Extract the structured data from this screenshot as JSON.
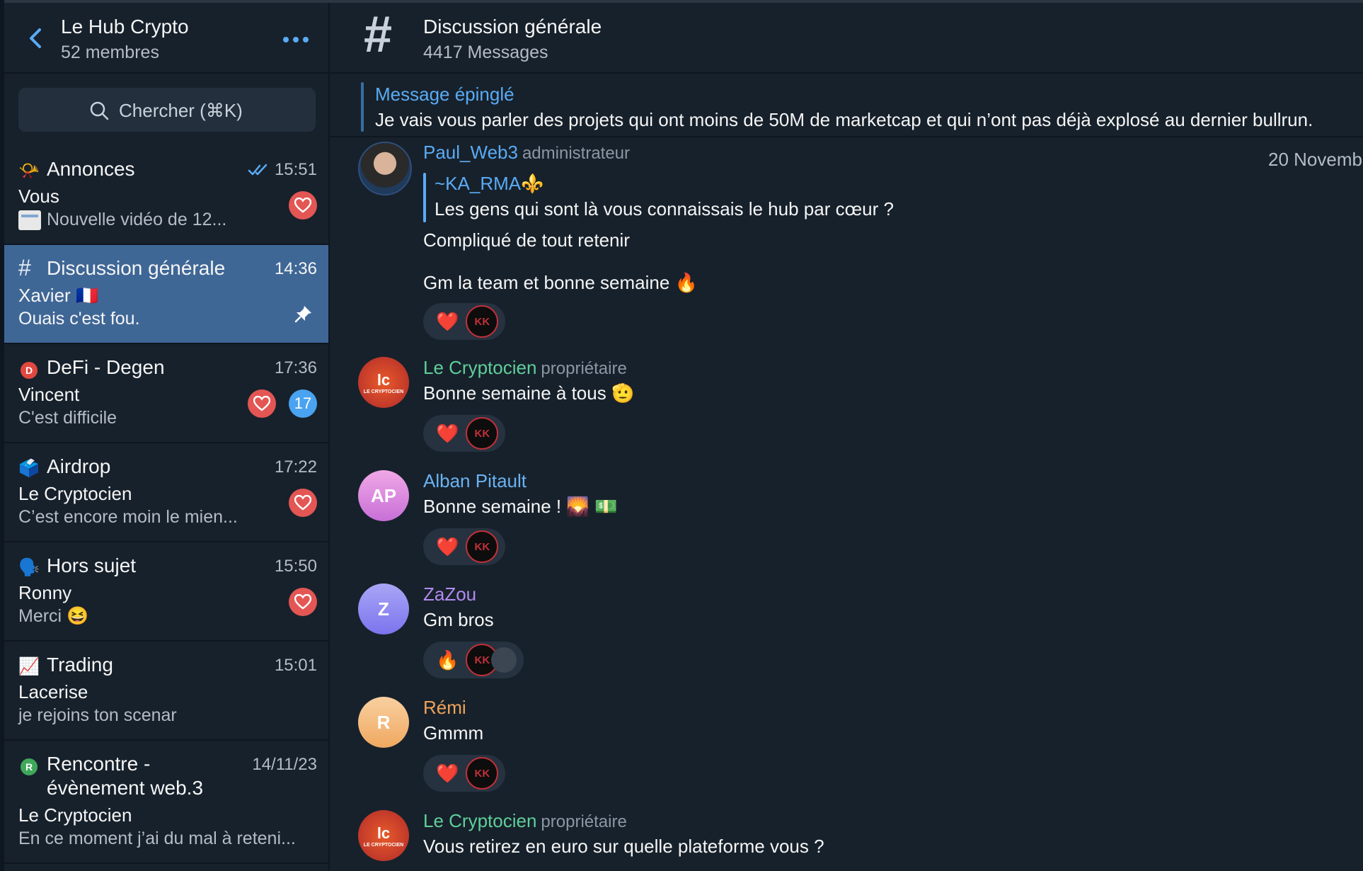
{
  "sidebar": {
    "title": "Le Hub Crypto",
    "subtitle": "52 membres",
    "search_placeholder": "Chercher (⌘K)",
    "chats": [
      {
        "emoji": "📯",
        "title": "Annonces",
        "time": "15:51",
        "sender": "Vous",
        "preview": "Nouvelle vidéo de 12..."
      },
      {
        "emoji": "#",
        "title": "Discussion générale",
        "time": "14:36",
        "sender": "Xavier 🇫🇷",
        "preview": "Ouais c'est fou."
      },
      {
        "emoji": "D",
        "title": "DeFi - Degen",
        "time": "17:36",
        "sender": "Vincent",
        "preview": "C'est difficile",
        "unread": "17"
      },
      {
        "emoji": "🗳️",
        "title": "Airdrop",
        "time": "17:22",
        "sender": "Le Cryptocien",
        "preview": "C’est encore moin le mien..."
      },
      {
        "emoji": "🗣️",
        "title": "Hors sujet",
        "time": "15:50",
        "sender": "Ronny",
        "preview": "Merci 😆"
      },
      {
        "emoji": "📈",
        "title": "Trading",
        "time": "15:01",
        "sender": "Lacerise",
        "preview": "je rejoins ton scenar"
      },
      {
        "emoji": "R",
        "title": "Rencontre - évènement web.3",
        "time": "14/11/23",
        "sender": "Le Cryptocien",
        "preview": "En ce moment j’ai du mal à reteni..."
      }
    ]
  },
  "colors": {
    "background": "#17212b",
    "active_item": "#3f6796",
    "accent": "#5aabf5",
    "heart_badge": "#e35654",
    "unread_badge": "#4aa3f0"
  },
  "main": {
    "channel_title": "Discussion générale",
    "channel_subtitle": "4417 Messages",
    "pinned_label": "Message épinglé",
    "pinned_text": "Je vais vous parler des projets qui ont moins de 50M de marketcap et qui n’ont pas déjà explosé au dernier bullrun.",
    "date": "20 Novemb",
    "messages": [
      {
        "author": "Paul_Web3",
        "role": "administrateur",
        "reply_name": "~KA_RMA⚜️",
        "reply_text": "Les gens qui sont là vous connaissais le hub par cœur ?",
        "lines": [
          "Compliqué de tout retenir",
          "Gm la team et bonne semaine 🔥"
        ],
        "reaction": "❤️"
      },
      {
        "author": "Le Cryptocien",
        "role": "propriétaire",
        "text": "Bonne semaine à tous 🫡",
        "reaction": "❤️",
        "avatar_text": "LE CRYPTOCIEN"
      },
      {
        "author": "Alban Pitault",
        "initials": "AP",
        "text": "Bonne semaine ! 🌄 💵",
        "reaction": "❤️"
      },
      {
        "author": "ZaZou",
        "initials": "Z",
        "text": "Gm bros",
        "reaction": "🔥"
      },
      {
        "author": "Rémi",
        "initials": "R",
        "text": "Gmmm",
        "reaction": "❤️"
      },
      {
        "author": "Le Cryptocien",
        "role": "propriétaire",
        "text": "Vous retirez en euro sur quelle plateforme vous ?",
        "avatar_text": "LE CRYPTOCIEN"
      }
    ],
    "reaction_avatar_text": "KK"
  }
}
